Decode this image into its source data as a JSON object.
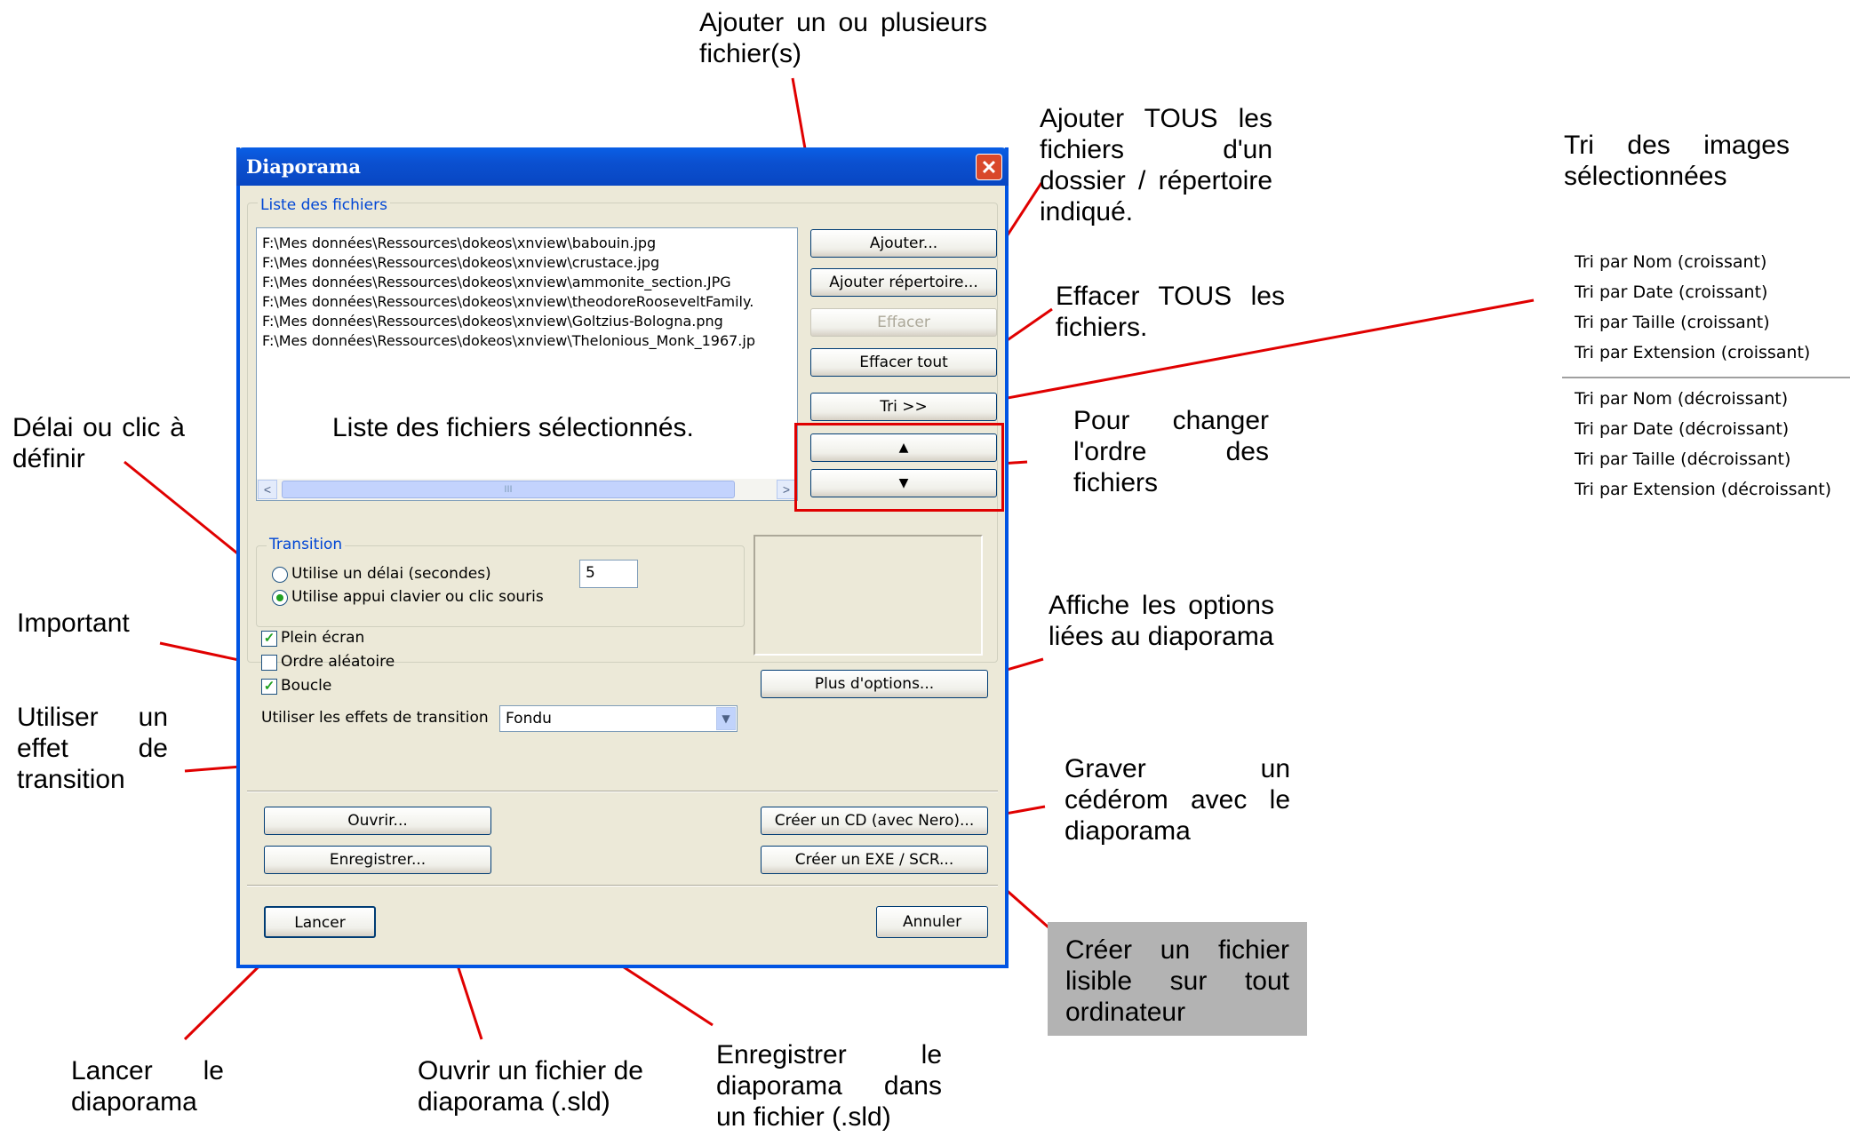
{
  "dialog": {
    "title": "Diaporama",
    "close_glyph": "✕",
    "files_group_label": "Liste des fichiers",
    "files": [
      "F:\\Mes données\\Ressources\\dokeos\\xnview\\babouin.jpg",
      "F:\\Mes données\\Ressources\\dokeos\\xnview\\crustace.jpg",
      "F:\\Mes données\\Ressources\\dokeos\\xnview\\ammonite_section.JPG",
      "F:\\Mes données\\Ressources\\dokeos\\xnview\\theodoreRooseveltFamily.",
      "F:\\Mes données\\Ressources\\dokeos\\xnview\\Goltzius-Bologna.png",
      "F:\\Mes données\\Ressources\\dokeos\\xnview\\Thelonious_Monk_1967.jp"
    ],
    "buttons": {
      "add": "Ajouter...",
      "add_dir": "Ajouter répertoire...",
      "delete": "Effacer",
      "delete_all": "Effacer tout",
      "sort": "Tri >>",
      "up": "▲",
      "down": "▼",
      "more_options": "Plus d'options...",
      "open": "Ouvrir...",
      "save": "Enregistrer...",
      "burn_cd": "Créer un CD (avec Nero)...",
      "create_exe": "Créer un EXE / SCR...",
      "launch": "Lancer",
      "cancel": "Annuler"
    },
    "scroll": {
      "left": "<",
      "right": ">",
      "grip": "III"
    },
    "transition_group_label": "Transition",
    "radio_delay": "Utilise un délai (secondes)",
    "radio_key": "Utilise appui clavier ou clic souris",
    "delay_value": "5",
    "check_fullscreen": "Plein écran",
    "check_random": "Ordre aléatoire",
    "check_loop": "Boucle",
    "check_mark": "✓",
    "effects_label": "Utiliser les effets de transition",
    "effects_value": "Fondu",
    "dropdown_glyph": "▼"
  },
  "annotations": {
    "add_one": "Ajouter un ou plusieurs fichier(s)",
    "add_all": "Ajouter TOUS les fichiers d'un dossier / répertoire indiqué.",
    "sort_images": "Tri des images sélectionnées",
    "delete_all": "Effacer TOUS les fichiers.",
    "change_order": "Pour changer l'ordre des fichiers",
    "delay": "Délai ou clic à définir",
    "list": "Liste des fichiers sélectionnés.",
    "important": "Important",
    "options": "Affiche les options liées au diaporama",
    "effect": "Utiliser un effet de transition",
    "burn": "Graver un cédérom avec le diaporama",
    "exe": "Créer un fichier lisible sur tout ordinateur",
    "launch": "Lancer le diaporama",
    "open": "Ouvrir un fichier de diaporama (.sld)",
    "save": "Enregistrer le diaporama dans un fichier (.sld)"
  },
  "sort_menu": {
    "ascending": [
      "Tri par Nom (croissant)",
      "Tri par Date (croissant)",
      "Tri par Taille (croissant)",
      "Tri par Extension (croissant)"
    ],
    "descending": [
      "Tri par Nom (décroissant)",
      "Tri par Date (décroissant)",
      "Tri par Taille (décroissant)",
      "Tri par Extension (décroissant)"
    ]
  },
  "colors": {
    "annotation_line": "#e00000",
    "titlebar": "#0a5fe6",
    "dialog_bg": "#ece9d8"
  }
}
